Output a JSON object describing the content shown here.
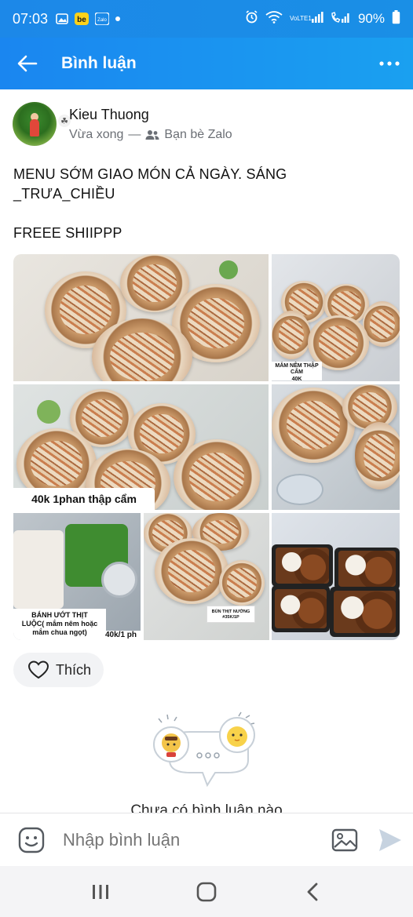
{
  "status_bar": {
    "time": "07:03",
    "zalo_label": "Zalo",
    "network_label": "VoLTE1",
    "battery": "90%"
  },
  "header": {
    "title": "Bình luận"
  },
  "post": {
    "author_name": "Kieu Thuong",
    "timestamp": "Vừa xong",
    "separator": "—",
    "audience": "Bạn bè Zalo",
    "text_line1": "MENU SỚM GIAO MÓN CẢ NGÀY. SÁNG",
    "text_line2": "_TRƯA_CHIỀU",
    "text_line3": "FREEE SHIIPPP",
    "photo_captions": {
      "cap1": "MẮM NÊM THẬP CẨM\n40K",
      "cap2": "40k 1phan thập cẩm",
      "cap3": "BÁNH ƯỚT THỊT\nLUỘC( mắm nêm hoặc\nmắm chua ngọt)",
      "cap4": "40k/1 ph",
      "cap5": "BÚN THỊT NƯỚNG\n#35K/1P"
    },
    "like_label": "Thích"
  },
  "empty_state": {
    "text": "Chưa có bình luận nào"
  },
  "composer": {
    "placeholder": "Nhập bình luận"
  },
  "colors": {
    "header_start": "#1a86f0",
    "header_end": "#1aa0f0",
    "send_disabled": "#c7d3e0"
  }
}
